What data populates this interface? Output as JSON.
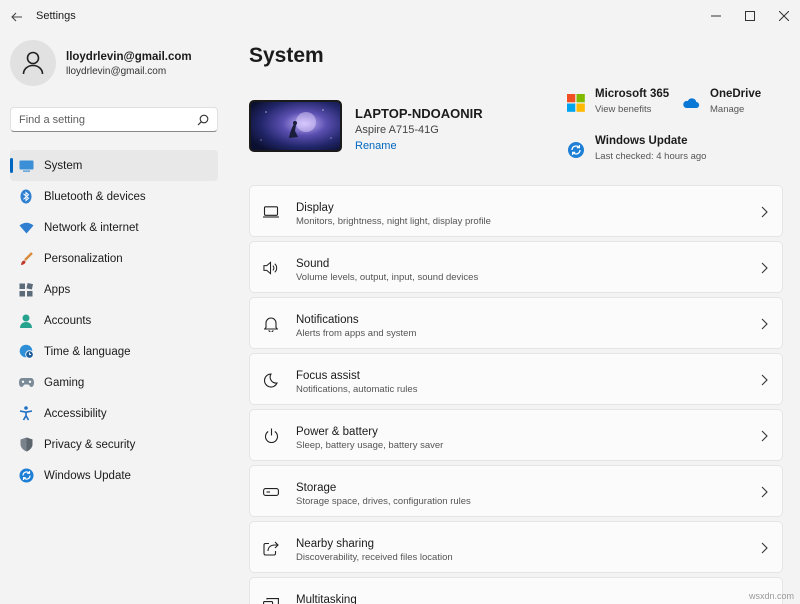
{
  "window": {
    "title": "Settings"
  },
  "profile": {
    "name": "lloydrlevin@gmail.com",
    "email": "lloydrlevin@gmail.com"
  },
  "search": {
    "placeholder": "Find a setting"
  },
  "sidebar": {
    "items": [
      {
        "label": "System",
        "icon": "system-icon",
        "active": true
      },
      {
        "label": "Bluetooth & devices",
        "icon": "bluetooth-icon"
      },
      {
        "label": "Network & internet",
        "icon": "wifi-icon"
      },
      {
        "label": "Personalization",
        "icon": "brush-icon"
      },
      {
        "label": "Apps",
        "icon": "apps-icon"
      },
      {
        "label": "Accounts",
        "icon": "person-icon"
      },
      {
        "label": "Time & language",
        "icon": "globe-clock-icon"
      },
      {
        "label": "Gaming",
        "icon": "gamepad-icon"
      },
      {
        "label": "Accessibility",
        "icon": "accessibility-icon"
      },
      {
        "label": "Privacy & security",
        "icon": "shield-icon"
      },
      {
        "label": "Windows Update",
        "icon": "update-icon"
      }
    ]
  },
  "main": {
    "title": "System",
    "device": {
      "name": "LAPTOP-NDOAONIR",
      "model": "Aspire A715-41G",
      "rename": "Rename"
    },
    "quick_links": {
      "microsoft365": {
        "title": "Microsoft 365",
        "sub": "View benefits"
      },
      "onedrive": {
        "title": "OneDrive",
        "sub": "Manage"
      },
      "windows_update": {
        "title": "Windows Update",
        "sub": "Last checked: 4 hours ago"
      }
    },
    "cards": [
      {
        "title": "Display",
        "sub": "Monitors, brightness, night light, display profile",
        "icon": "display-icon"
      },
      {
        "title": "Sound",
        "sub": "Volume levels, output, input, sound devices",
        "icon": "speaker-icon"
      },
      {
        "title": "Notifications",
        "sub": "Alerts from apps and system",
        "icon": "bell-icon"
      },
      {
        "title": "Focus assist",
        "sub": "Notifications, automatic rules",
        "icon": "moon-icon"
      },
      {
        "title": "Power & battery",
        "sub": "Sleep, battery usage, battery saver",
        "icon": "power-icon"
      },
      {
        "title": "Storage",
        "sub": "Storage space, drives, configuration rules",
        "icon": "storage-icon"
      },
      {
        "title": "Nearby sharing",
        "sub": "Discoverability, received files location",
        "icon": "share-icon"
      },
      {
        "title": "Multitasking",
        "sub": "",
        "icon": "multitasking-icon"
      }
    ]
  },
  "watermark": "wsxdn.com",
  "colors": {
    "accent": "#0067c0",
    "background": "#f3f3f3",
    "card": "#fbfbfb"
  }
}
